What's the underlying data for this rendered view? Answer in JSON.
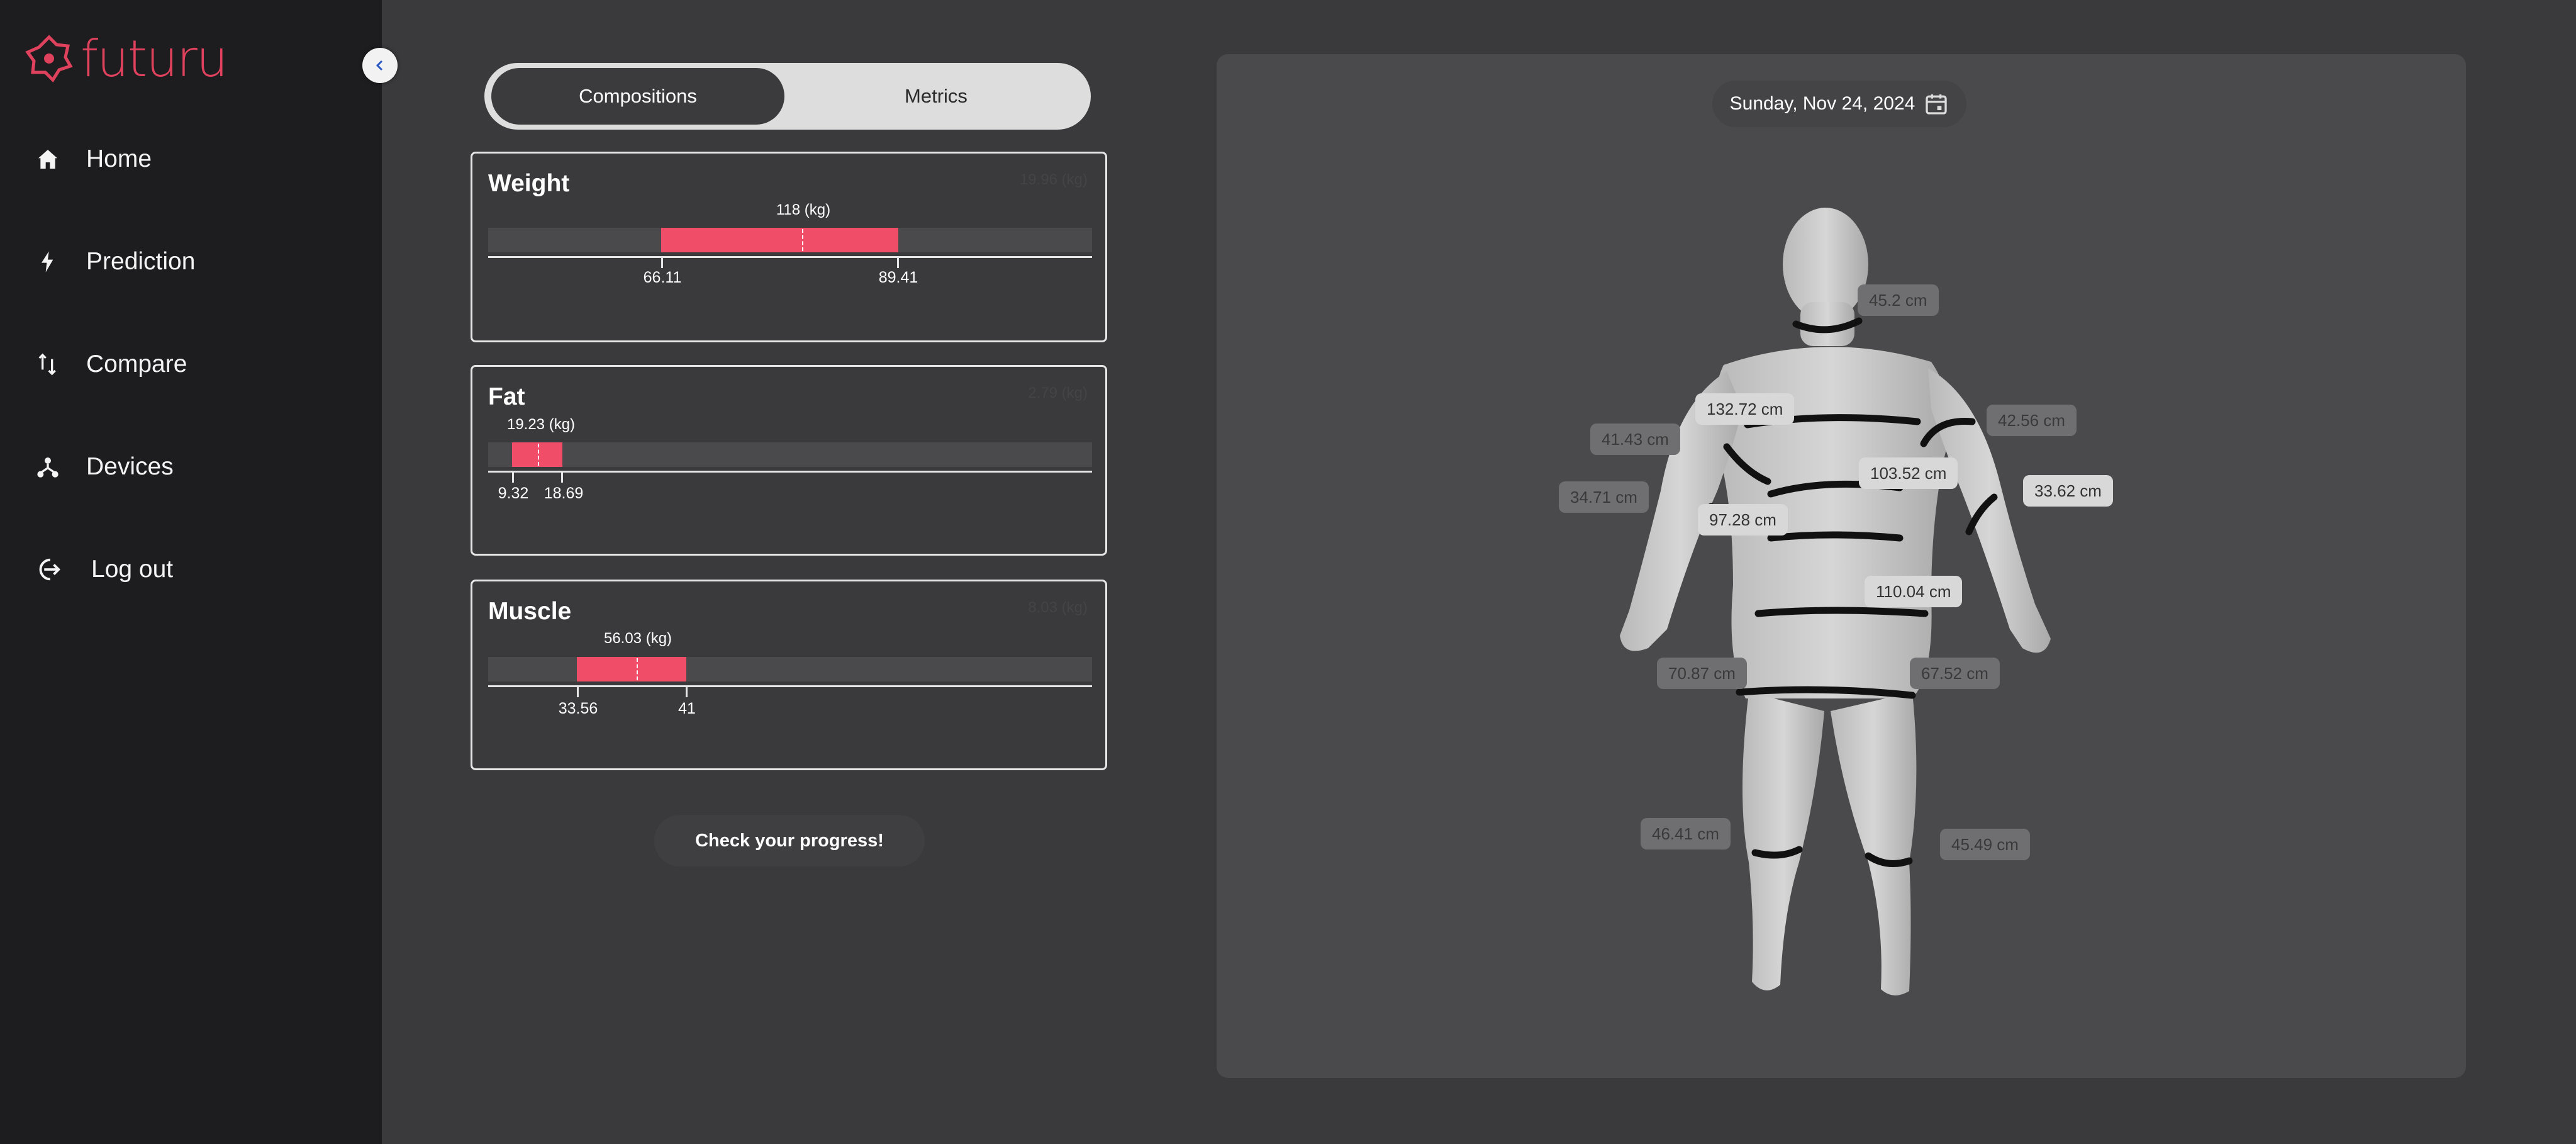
{
  "app": {
    "logo_text": "futuru",
    "accent_color": "#f04d68",
    "brand_color": "#e0415d",
    "collapse_icon": "chevron-left-icon"
  },
  "sidebar": {
    "items": [
      {
        "label": "Home",
        "icon": "home-icon"
      },
      {
        "label": "Prediction",
        "icon": "lightning-icon"
      },
      {
        "label": "Compare",
        "icon": "swap-vertical-icon"
      },
      {
        "label": "Devices",
        "icon": "network-icon"
      },
      {
        "label": "Log out",
        "icon": "logout-icon"
      }
    ]
  },
  "tabs": [
    {
      "label": "Compositions",
      "active": true
    },
    {
      "label": "Metrics",
      "active": false
    }
  ],
  "compositions": [
    {
      "title": "Weight",
      "value_label": "118 (kg)",
      "min": "66.11",
      "max": "89.41",
      "corner": "19.96 (kg)"
    },
    {
      "title": "Fat",
      "value_label": "19.23 (kg)",
      "min": "9.32",
      "max": "18.69",
      "corner": "2.79 (kg)"
    },
    {
      "title": "Muscle",
      "value_label": "56.03 (kg)",
      "min": "33.56",
      "max": "41",
      "corner": "8.03 (kg)"
    }
  ],
  "progress_button": "Check your progress!",
  "body_view": {
    "date": "Sunday, Nov 24, 2024",
    "date_icon": "calendar-icon",
    "measurements": [
      {
        "id": "neck",
        "value": "45.2 cm"
      },
      {
        "id": "chest",
        "value": "132.72 cm"
      },
      {
        "id": "shoulder-left",
        "value": "41.43 cm"
      },
      {
        "id": "upper-arm-right",
        "value": "42.56 cm"
      },
      {
        "id": "forearm-left",
        "value": "34.71 cm"
      },
      {
        "id": "waist-upper",
        "value": "103.52 cm"
      },
      {
        "id": "forearm-right",
        "value": "33.62 cm"
      },
      {
        "id": "waist",
        "value": "97.28 cm"
      },
      {
        "id": "hips",
        "value": "110.04 cm"
      },
      {
        "id": "thigh-left",
        "value": "70.87 cm"
      },
      {
        "id": "thigh-right",
        "value": "67.52 cm"
      },
      {
        "id": "calf-left",
        "value": "46.41 cm"
      },
      {
        "id": "calf-right",
        "value": "45.49 cm"
      }
    ]
  }
}
